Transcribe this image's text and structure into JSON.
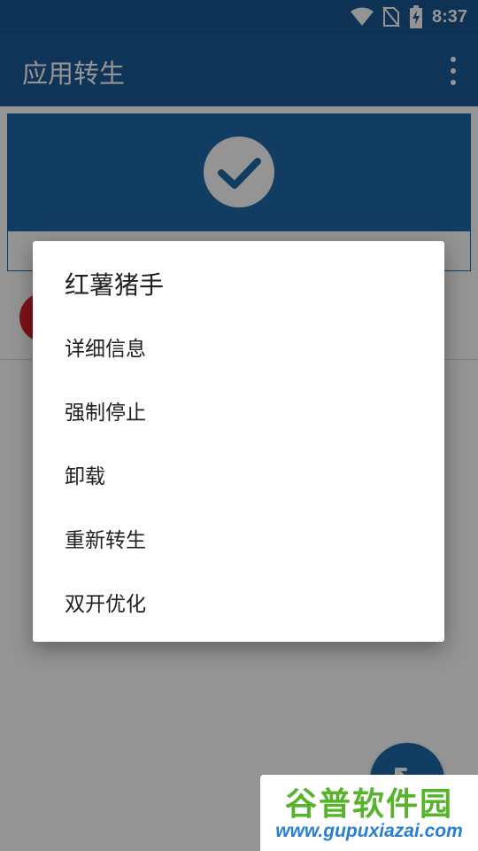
{
  "status_bar": {
    "time": "8:37"
  },
  "app_bar": {
    "title": "应用转生"
  },
  "dialog": {
    "title": "红薯猪手",
    "items": [
      {
        "label": "详细信息"
      },
      {
        "label": "强制停止"
      },
      {
        "label": "卸载"
      },
      {
        "label": "重新转生"
      },
      {
        "label": "双开优化"
      }
    ]
  },
  "watermark": {
    "logo": "谷普软件园",
    "url": "www.gupuxiazai.com"
  },
  "icons": {
    "wifi": "wifi-icon",
    "no_sim": "no-sim-icon",
    "battery": "battery-charging-icon",
    "overflow": "more-vert-icon",
    "check": "check-circle-icon",
    "fab": "expand-icon"
  },
  "colors": {
    "primary": "#1a5b96",
    "primary_dark": "#17568f",
    "accent": "#1f6aab",
    "watermark_green": "#57b32b",
    "watermark_blue": "#2a7fd0"
  }
}
